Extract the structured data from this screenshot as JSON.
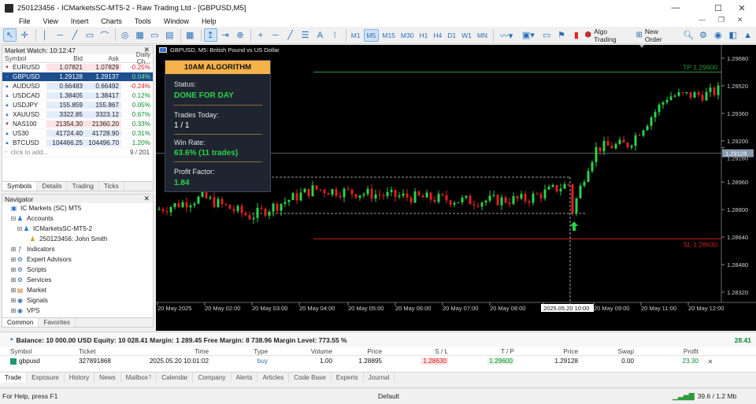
{
  "window": {
    "title": "250123456 - ICMarketsSC-MT5-2 - Raw Trading Ltd - [GBPUSD,M5]"
  },
  "menu": [
    "File",
    "View",
    "Insert",
    "Charts",
    "Tools",
    "Window",
    "Help"
  ],
  "toolbar": {
    "timeframes": [
      "M1",
      "M5",
      "M15",
      "M30",
      "H1",
      "H4",
      "D1",
      "W1",
      "MN"
    ],
    "active_timeframe": "M5",
    "algo_trading": "Algo Trading",
    "new_order": "New Order"
  },
  "market_watch": {
    "title": "Market Watch: 10:12:47",
    "columns": [
      "Symbol",
      "Bid",
      "Ask",
      "Daily Ch..."
    ],
    "rows": [
      {
        "symbol": "EURUSD",
        "bid": "1.07821",
        "ask": "1.07829",
        "change": "-0.25%",
        "dir": "down",
        "neg": true
      },
      {
        "symbol": "GBPUSD",
        "bid": "1.29128",
        "ask": "1.29137",
        "change": "0.04%",
        "dir": "up",
        "neg": false,
        "selected": true
      },
      {
        "symbol": "AUDUSD",
        "bid": "0.66483",
        "ask": "0.66492",
        "change": "-0.24%",
        "dir": "up",
        "neg": true
      },
      {
        "symbol": "USDCAD",
        "bid": "1.38405",
        "ask": "1.38417",
        "change": "0.12%",
        "dir": "up",
        "neg": false
      },
      {
        "symbol": "USDJPY",
        "bid": "155.859",
        "ask": "155.867",
        "change": "0.05%",
        "dir": "up",
        "neg": false
      },
      {
        "symbol": "XAUUSD",
        "bid": "3322.85",
        "ask": "3323.12",
        "change": "0.67%",
        "dir": "up",
        "neg": false
      },
      {
        "symbol": "NAS100",
        "bid": "21354.30",
        "ask": "21360.20",
        "change": "0.33%",
        "dir": "down",
        "neg": false
      },
      {
        "symbol": "US30",
        "bid": "41724.40",
        "ask": "41728.90",
        "change": "0.31%",
        "dir": "up",
        "neg": false
      },
      {
        "symbol": "BTCUSD",
        "bid": "104466.25",
        "ask": "104496.70",
        "change": "1.20%",
        "dir": "up",
        "neg": false
      }
    ],
    "add_label": "click to add...",
    "count": "9 / 201",
    "tabs": [
      "Symbols",
      "Details",
      "Trading",
      "Ticks"
    ]
  },
  "navigator": {
    "title": "Navigator",
    "items": [
      {
        "label": "IC Markets (SC) MT5",
        "level": 0,
        "plus": "",
        "icon": "broker-icon"
      },
      {
        "label": "Accounts",
        "level": 1,
        "plus": "⊟",
        "icon": "accounts-icon"
      },
      {
        "label": "ICMarketsSC-MT5-2",
        "level": 2,
        "plus": "⊟",
        "icon": "server-icon"
      },
      {
        "label": "250123456: John Smith",
        "level": 3,
        "plus": "",
        "icon": "user-icon"
      },
      {
        "label": "Indicators",
        "level": 1,
        "plus": "⊞",
        "icon": "indicators-icon"
      },
      {
        "label": "Expert Advisors",
        "level": 1,
        "plus": "⊞",
        "icon": "expert-icon"
      },
      {
        "label": "Scripts",
        "level": 1,
        "plus": "⊞",
        "icon": "scripts-icon"
      },
      {
        "label": "Services",
        "level": 1,
        "plus": "⊞",
        "icon": "services-icon"
      },
      {
        "label": "Market",
        "level": 1,
        "plus": "⊞",
        "icon": "market-icon"
      },
      {
        "label": "Signals",
        "level": 1,
        "plus": "⊞",
        "icon": "signals-icon"
      },
      {
        "label": "VPS",
        "level": 1,
        "plus": "⊞",
        "icon": "vps-icon"
      }
    ],
    "tabs": [
      "Common",
      "Favorites"
    ]
  },
  "chart": {
    "symbol_label": "GBPUSD, M5:  British Pound vs US Dollar",
    "price_labels": [
      "1.29680",
      "1.29520",
      "1.29360",
      "1.29200",
      "1.29160",
      "1.28960",
      "1.28800",
      "1.28640",
      "1.28480",
      "1.28320"
    ],
    "current_price": "1.29128",
    "tp_label": "TP 1.29600",
    "sl_label": "SL 1.28630",
    "time_labels": [
      "20 May 2025",
      "20 May 02:00",
      "20 May 03:00",
      "20 May 04:00",
      "20 May 05:00",
      "20 May 06:00",
      "20 May 07:00",
      "20 May 08:00",
      "2025.05.20 10:00",
      "20 May 09:00",
      "20 May 11:00",
      "20 May 12:00"
    ],
    "colors": {
      "bull": "#2bd24a",
      "bear": "#e02020",
      "tp": "#2e9a3a",
      "sl": "#d62020",
      "current": "#8a9ab0"
    }
  },
  "algo_panel": {
    "title": "10AM ALGORITHM",
    "status_label": "Status:",
    "status_value": "DONE FOR DAY",
    "trades_label": "Trades Today:",
    "trades_value": "1 / 1",
    "winrate_label": "Win Rate:",
    "winrate_value": "63.6% (11 trades)",
    "pf_label": "Profit Factor:",
    "pf_value": "1.84"
  },
  "balance_bar": {
    "text": "Balance: 10 000.00 USD  Equity: 10 028.41  Margin: 1 289.45  Free Margin: 8 738.96  Margin Level: 773.55 %",
    "profit": "28.41"
  },
  "trades": {
    "columns": [
      "Symbol",
      "Ticket",
      "Time",
      "Type",
      "Volume",
      "Price",
      "S / L",
      "T / P",
      "Price",
      "Swap",
      "Profit"
    ],
    "rows": [
      {
        "symbol": "gbpusd",
        "ticket": "327891868",
        "time": "2025.05.20 10:01:02",
        "type": "buy",
        "volume": "1.00",
        "price": "1.28895",
        "sl": "1.28630",
        "tp": "1.29600",
        "current": "1.29128",
        "swap": "0.00",
        "profit": "23.30"
      }
    ]
  },
  "bottom_tabs": [
    "Trade",
    "Exposure",
    "History",
    "News",
    "Mailbox",
    "Calendar",
    "Company",
    "Alerts",
    "Articles",
    "Code Base",
    "Experts",
    "Journal"
  ],
  "mailbox_badge": "7",
  "status_bar": {
    "help": "For Help, press F1",
    "profile": "Default",
    "network": "39.6 / 1.2 Mb"
  }
}
